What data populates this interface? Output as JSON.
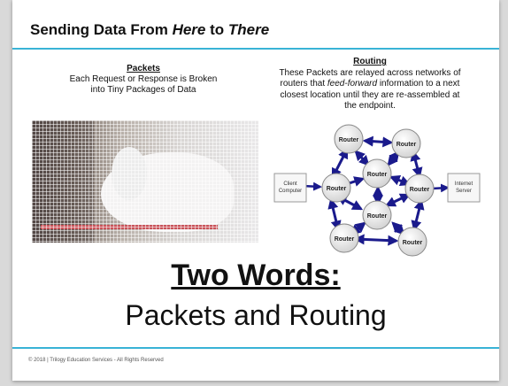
{
  "slide": {
    "title_pre": "Sending Data From ",
    "title_here": "Here",
    "title_mid": " to ",
    "title_there": "There",
    "packets": {
      "heading": "Packets",
      "line1": "Each Request or Response is Broken",
      "line2": "into Tiny Packages of Data"
    },
    "routing": {
      "heading": "Routing",
      "line1": "These Packets are relayed across networks of",
      "line2_pre": "routers that ",
      "line2_em": "feed-forward",
      "line2_post": " information to a next",
      "line3": "closest location until they are re-assembled at",
      "line4": "the endpoint."
    },
    "big_title": "Two Words:",
    "big_subtitle": "Packets and Routing",
    "footer": "© 2018 | Trilogy Education Services - All Rights Reserved"
  },
  "diagram": {
    "router_label": "Router",
    "client_label_1": "Client",
    "client_label_2": "Computer",
    "server_label_1": "Internet",
    "server_label_2": "Server"
  },
  "colors": {
    "accent_rule": "#39b3d6",
    "arrow": "#1a1a8c"
  }
}
